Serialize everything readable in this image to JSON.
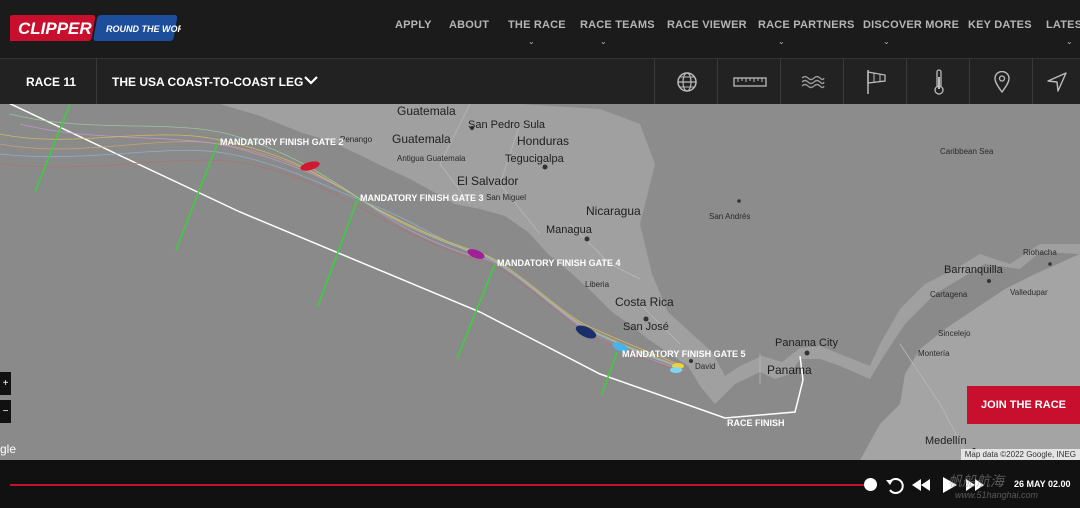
{
  "brand": {
    "logo_text": "CLIPPER",
    "logo_tag": "ROUND THE WORLD"
  },
  "nav": [
    {
      "label": "APPLY",
      "caret": false
    },
    {
      "label": "ABOUT",
      "caret": false
    },
    {
      "label": "THE RACE",
      "caret": true
    },
    {
      "label": "RACE TEAMS",
      "caret": true
    },
    {
      "label": "RACE VIEWER",
      "caret": false
    },
    {
      "label": "RACE PARTNERS",
      "caret": true
    },
    {
      "label": "DISCOVER MORE",
      "caret": true
    },
    {
      "label": "KEY DATES",
      "caret": false
    },
    {
      "label": "LATEST",
      "caret": true
    }
  ],
  "race_bar": {
    "race_number": "RACE 11",
    "leg_title": "THE USA COAST-TO-COAST LEG",
    "tools": [
      "globe-icon",
      "ruler-icon",
      "waves-icon",
      "windsock-icon",
      "thermometer-icon",
      "location-pin-icon",
      "navigation-arrow-icon"
    ]
  },
  "map": {
    "places": [
      {
        "name": "Guatemala",
        "size": "big"
      },
      {
        "name": "Guatemala",
        "size": "big"
      },
      {
        "name": "San Pedro Sula",
        "size": "normal"
      },
      {
        "name": "Honduras",
        "size": "big"
      },
      {
        "name": "Tegucigalpa",
        "size": "normal"
      },
      {
        "name": "El Salvador",
        "size": "big"
      },
      {
        "name": "San Miguel",
        "size": "small"
      },
      {
        "name": "Antigua Guatemala",
        "size": "small"
      },
      {
        "name": "Nicaragua",
        "size": "big"
      },
      {
        "name": "Managua",
        "size": "normal"
      },
      {
        "name": "San Andrés",
        "size": "small"
      },
      {
        "name": "Caribbean Sea",
        "size": "small"
      },
      {
        "name": "Liberia",
        "size": "small"
      },
      {
        "name": "Costa Rica",
        "size": "big"
      },
      {
        "name": "San José",
        "size": "normal"
      },
      {
        "name": "David",
        "size": "small"
      },
      {
        "name": "Panama City",
        "size": "normal"
      },
      {
        "name": "Panama",
        "size": "big"
      },
      {
        "name": "Barranquilla",
        "size": "normal"
      },
      {
        "name": "Riohacha",
        "size": "small"
      },
      {
        "name": "Cartagena",
        "size": "small"
      },
      {
        "name": "Valledupar",
        "size": "small"
      },
      {
        "name": "Sincelejo",
        "size": "small"
      },
      {
        "name": "Montería",
        "size": "small"
      },
      {
        "name": "Medellín",
        "size": "normal"
      },
      {
        "name": "Penango",
        "size": "small"
      }
    ],
    "gates": [
      {
        "label": "MANDATORY FINISH GATE 2"
      },
      {
        "label": "MANDATORY FINISH GATE 3"
      },
      {
        "label": "MANDATORY FINISH GATE 4"
      },
      {
        "label": "MANDATORY FINISH GATE 5"
      },
      {
        "label": "RACE FINISH"
      }
    ],
    "zoom_in": "+",
    "zoom_out": "−",
    "google_fragment": "gle",
    "attribution": "Map data ©2022 Google, INEG",
    "join_button": "JOIN THE RACE",
    "colors": {
      "land": "#9c9c9c",
      "sea": "#8a8a8a",
      "gate": "#3ccf3c",
      "route": "#ffffff",
      "accent": "#c8102e"
    }
  },
  "playback": {
    "timestamp": "26 MAY 02.00",
    "progress": 1.0,
    "controls": [
      "rewind-icon",
      "step-back-icon",
      "play-icon",
      "fast-forward-icon"
    ]
  },
  "watermark": {
    "main": "帆船航海",
    "sub": "www.51hanghai.com"
  }
}
